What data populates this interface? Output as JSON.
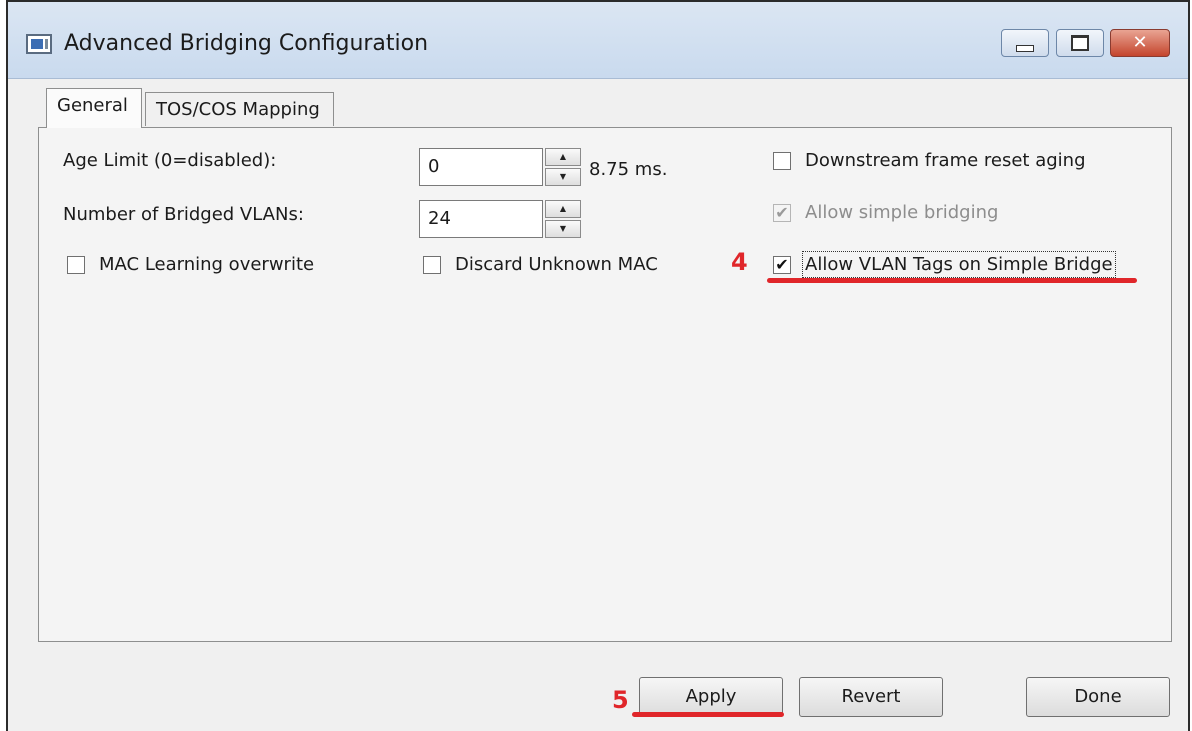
{
  "window": {
    "title": "Advanced Bridging Configuration",
    "icon": "app-window-icon",
    "controls": {
      "minimize": "minimize-icon",
      "maximize": "maximize-icon",
      "close": "close-icon",
      "close_glyph": "✕"
    }
  },
  "tabs": [
    {
      "label": "General",
      "active": true
    },
    {
      "label": "TOS/COS Mapping",
      "active": false
    }
  ],
  "general": {
    "age_limit": {
      "label": "Age Limit (0=disabled):",
      "value": "0",
      "unit_text": "8.75 ms."
    },
    "bridged_vlans": {
      "label": "Number of Bridged VLANs:",
      "value": "24"
    },
    "mac_learning_overwrite": {
      "label": "MAC Learning overwrite",
      "checked": false
    },
    "discard_unknown_mac": {
      "label": "Discard Unknown MAC",
      "checked": false
    },
    "downstream_frame_reset_aging": {
      "label": "Downstream frame reset aging",
      "checked": false
    },
    "allow_simple_bridging": {
      "label": "Allow simple bridging",
      "checked": true,
      "enabled": false
    },
    "allow_vlan_tags": {
      "label": "Allow VLAN Tags on Simple Bridge",
      "checked": true
    }
  },
  "spinner": {
    "up": "▲",
    "down": "▼"
  },
  "check_glyph": "✔",
  "annotations": {
    "step4": "4",
    "step5": "5",
    "color": "#e0262a"
  },
  "buttons": {
    "apply": "Apply",
    "revert": "Revert",
    "done": "Done"
  }
}
